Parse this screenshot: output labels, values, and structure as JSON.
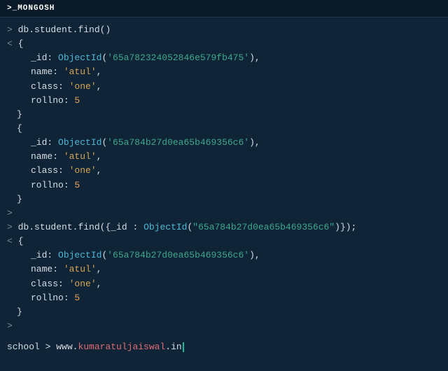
{
  "header": {
    "title": ">_MONGOSH"
  },
  "cmd1": "db.student.find()",
  "cmd2_pre": "db.student.find({_id : ",
  "cmd2_fn": "ObjectId",
  "cmd2_arg": "\"65a784b27d0ea65b469356c6\"",
  "cmd2_post": ")});",
  "sym": {
    "gt": ">",
    "lt": "<",
    "open": "{",
    "close": "}"
  },
  "keys": {
    "id": "_id",
    "name": "name",
    "class": "class",
    "rollno": "rollno"
  },
  "fn": {
    "oid": "ObjectId"
  },
  "doc": [
    {
      "oid": "'65a782324052846e579fb475'",
      "name": "'atul'",
      "class": "'one'",
      "rollno": "5"
    },
    {
      "oid": "'65a784b27d0ea65b469356c6'",
      "name": "'atul'",
      "class": "'one'",
      "rollno": "5"
    },
    {
      "oid": "'65a784b27d0ea65b469356c6'",
      "name": "'atul'",
      "class": "'one'",
      "rollno": "5"
    }
  ],
  "footer": {
    "db": "school",
    "sep": " > ",
    "u1": "www.",
    "u2": "kumaratuljaiswal",
    "u3": ".in"
  }
}
